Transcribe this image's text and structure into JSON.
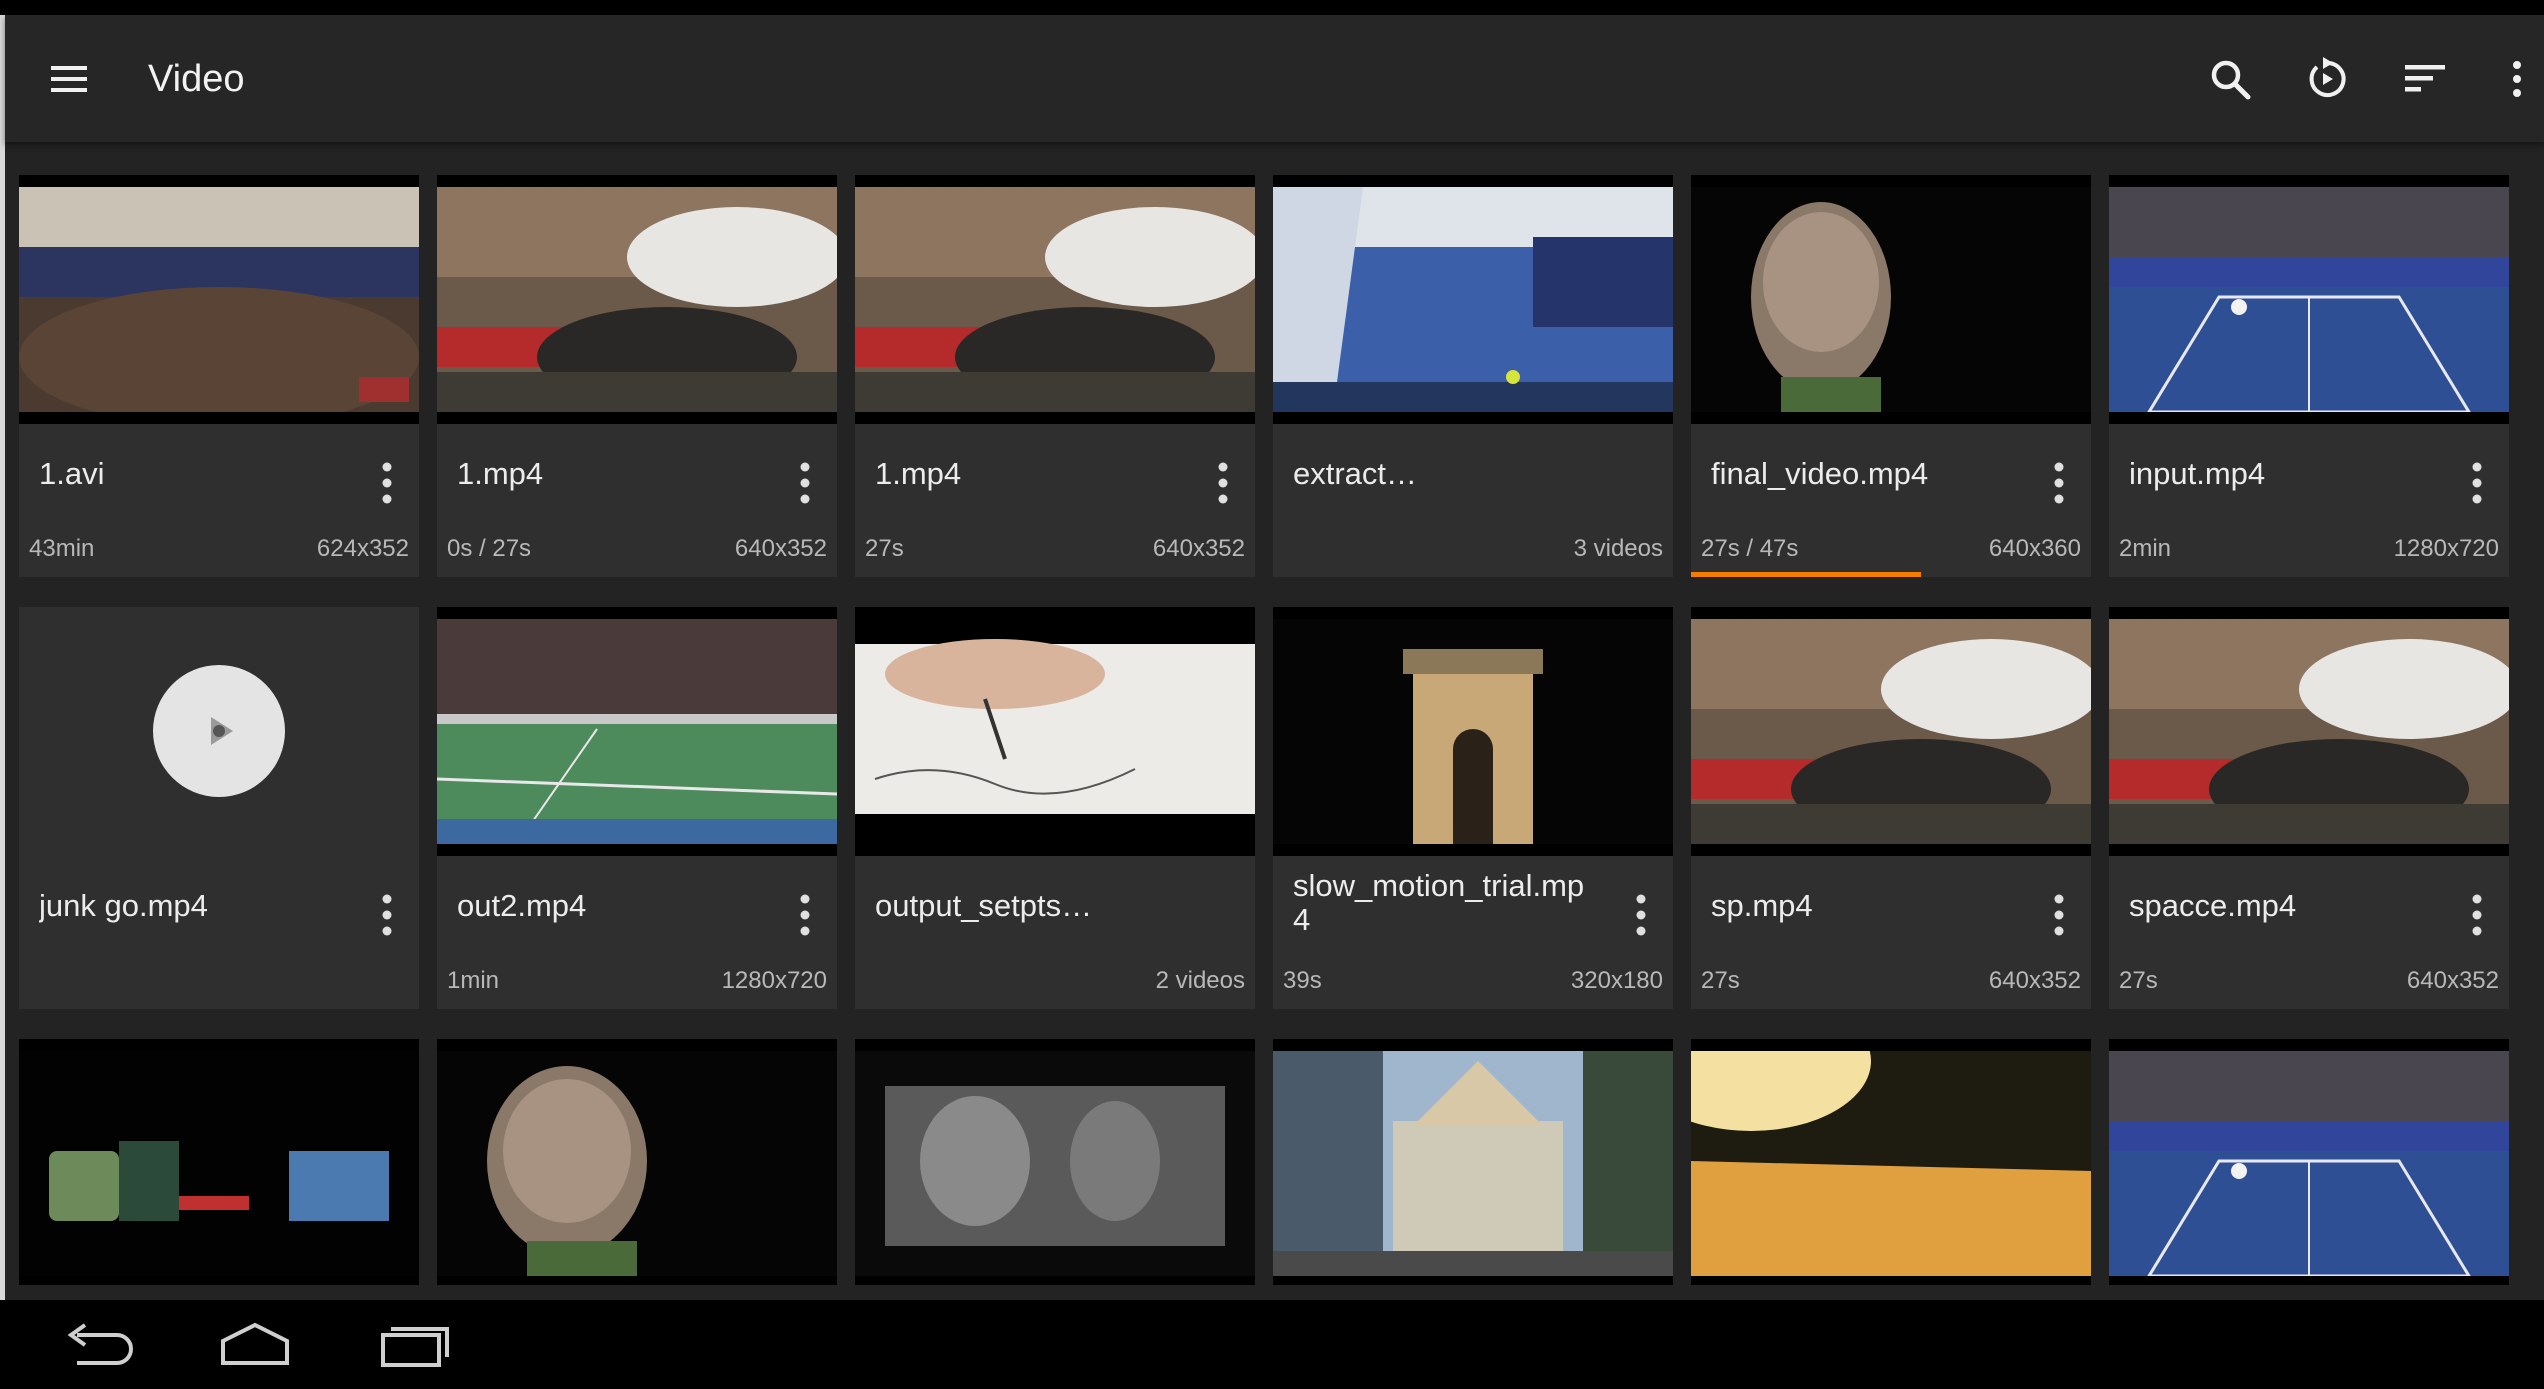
{
  "app": {
    "title": "Video",
    "accent_color": "#f57c00",
    "toolbar_icons": [
      "menu-icon",
      "search-icon",
      "refresh-icon",
      "sort-icon",
      "more-vert-icon"
    ]
  },
  "videos": [
    {
      "title": "1.avi",
      "left": "43min",
      "right": "624x352",
      "progress": 0
    },
    {
      "title": "1.mp4",
      "left": "0s / 27s",
      "right": "640x352",
      "progress": 0
    },
    {
      "title": "1.mp4",
      "left": "27s",
      "right": "640x352",
      "progress": 0
    },
    {
      "title": "extract…",
      "left": "",
      "right": "3 videos",
      "progress": 0
    },
    {
      "title": "final_video.mp4",
      "left": "27s / 47s",
      "right": "640x360",
      "progress": 0.574
    },
    {
      "title": "input.mp4",
      "left": "2min",
      "right": "1280x720",
      "progress": 0
    },
    {
      "title": "junk go.mp4",
      "left": "",
      "right": "",
      "progress": 0
    },
    {
      "title": "out2.mp4",
      "left": "1min",
      "right": "1280x720",
      "progress": 0
    },
    {
      "title": "output_setpts…",
      "left": "",
      "right": "2 videos",
      "progress": 0
    },
    {
      "title": "slow_motion_trial.mp\n4",
      "left": "39s",
      "right": "320x180",
      "progress": 0
    },
    {
      "title": "sp.mp4",
      "left": "27s",
      "right": "640x352",
      "progress": 0
    },
    {
      "title": "spacce.mp4",
      "left": "27s",
      "right": "640x352",
      "progress": 0
    }
  ],
  "nav": {
    "icons": [
      "back-icon",
      "home-icon",
      "recents-icon"
    ]
  }
}
